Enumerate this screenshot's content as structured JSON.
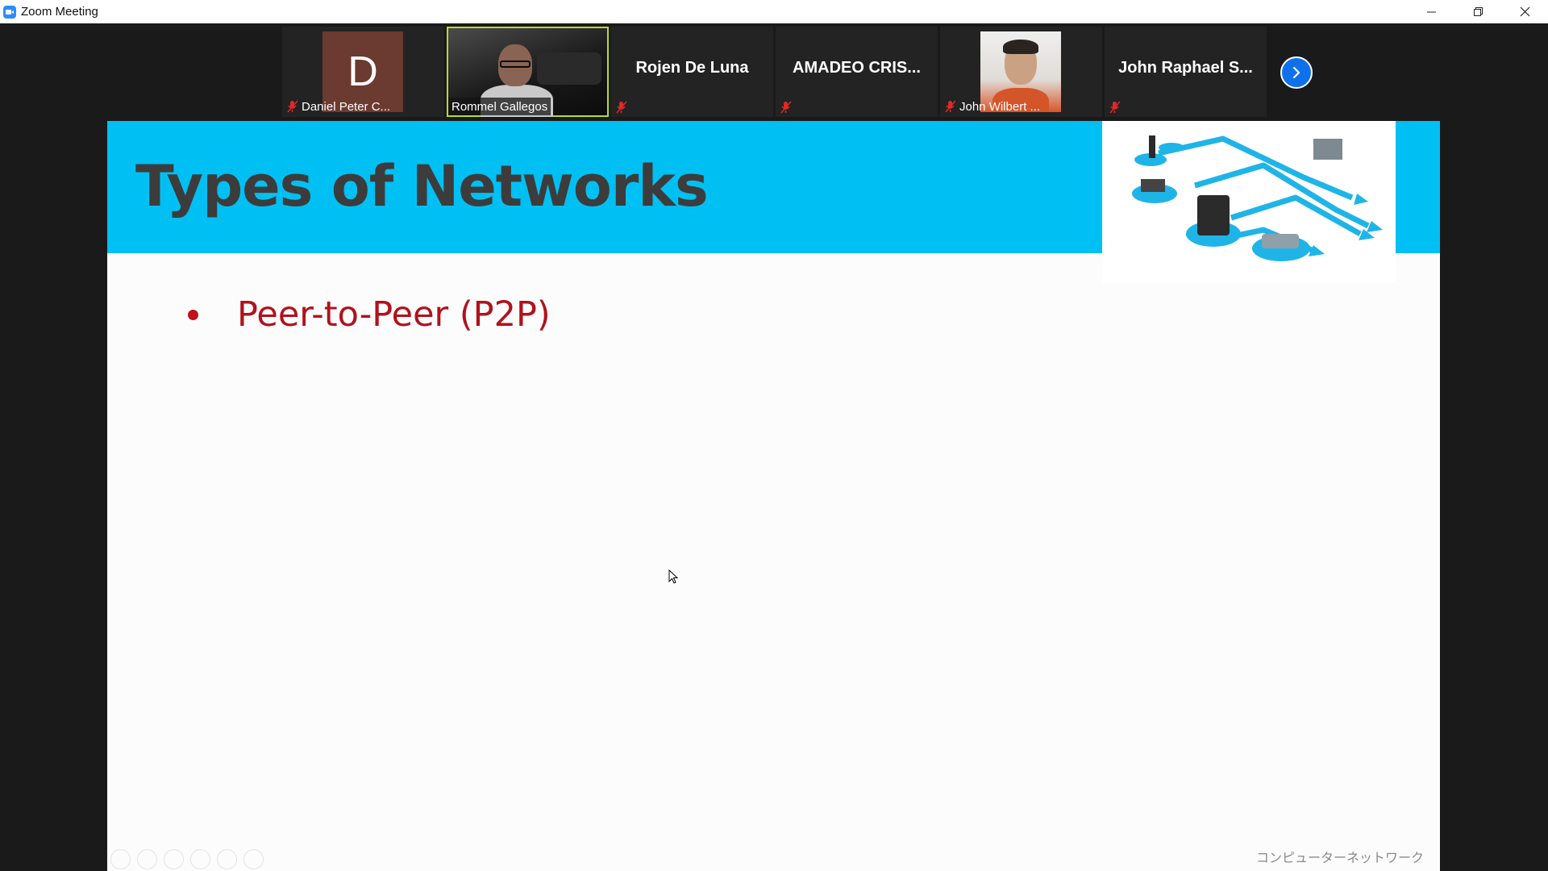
{
  "window": {
    "title": "Zoom Meeting",
    "controls": [
      "minimize",
      "restore",
      "close"
    ]
  },
  "participants": [
    {
      "name": "Daniel Peter C...",
      "display": "avatar",
      "avatar_letter": "D",
      "avatar_color": "#6b3a30",
      "muted": true
    },
    {
      "name": "Rommel Gallegos",
      "display": "video",
      "muted": false,
      "active_speaker": true
    },
    {
      "name": "Rojen De Luna",
      "display": "name",
      "muted": true
    },
    {
      "name": "AMADEO  CRIS...",
      "display": "name",
      "muted": true
    },
    {
      "name": "John Wilbert ...",
      "display": "photo",
      "muted": true
    },
    {
      "name": "John  Raphael  S...",
      "display": "name",
      "muted": true
    }
  ],
  "next_page_icon": "chevron-right-icon",
  "slide": {
    "title": "Types of Networks",
    "bullets": [
      "Peer-to-Peer (P2P)"
    ],
    "footer": "コンピューターネットワーク",
    "header_color": "#00c0f3",
    "title_color": "#3c3c3c",
    "bullet_color": "#b0121c",
    "graphic_icon": "network-diagram-icon"
  },
  "colors": {
    "accent": "#0e71eb",
    "active_speaker_border": "#b8d936",
    "mute_red": "#e02828"
  }
}
